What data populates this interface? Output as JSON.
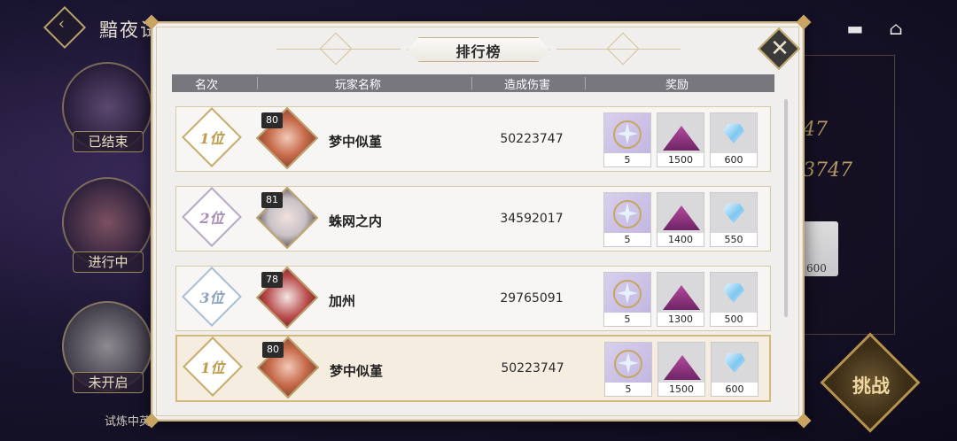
{
  "background": {
    "title": "黯夜试",
    "side_labels": [
      "已结束",
      "进行中",
      "未开启"
    ],
    "right_texts": [
      "47",
      "3747"
    ],
    "right_reward_qty": "600",
    "challenge_label": "挑战",
    "bottom_text": "试炼中英"
  },
  "modal": {
    "title": "排行榜",
    "columns": [
      "名次",
      "玩家名称",
      "造成伤害",
      "奖励"
    ]
  },
  "rows": [
    {
      "rank": "1位",
      "level": "80",
      "name": "梦中似堇",
      "damage": "50223747",
      "rewards": [
        "5",
        "1500",
        "600"
      ]
    },
    {
      "rank": "2位",
      "level": "81",
      "name": "蛛网之内",
      "damage": "34592017",
      "rewards": [
        "5",
        "1400",
        "550"
      ]
    },
    {
      "rank": "3位",
      "level": "78",
      "name": "加州",
      "damage": "29765091",
      "rewards": [
        "5",
        "1300",
        "500"
      ]
    }
  ],
  "self_row": {
    "rank": "1位",
    "level": "80",
    "name": "梦中似堇",
    "damage": "50223747",
    "rewards": [
      "5",
      "1500",
      "600"
    ]
  },
  "icons": {
    "back": "back-arrow-icon",
    "chat": "chat-icon",
    "home": "home-icon",
    "close": "close-icon",
    "reward_1": "star-compass-icon",
    "reward_2": "purple-powder-icon",
    "reward_3": "crystal-icon"
  }
}
